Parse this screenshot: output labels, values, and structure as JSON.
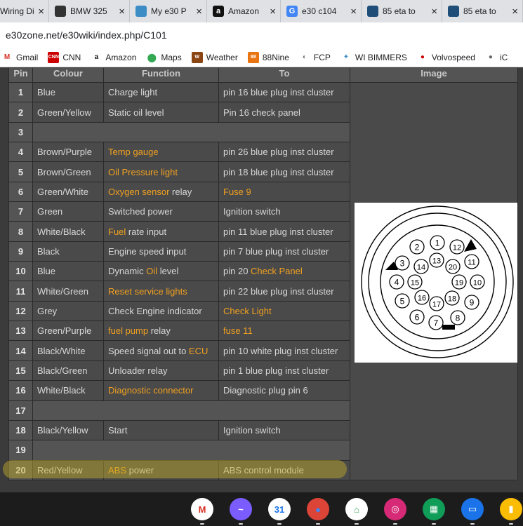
{
  "tabs": [
    {
      "title": "Wiring Di",
      "icon": "wiring-icon",
      "color": "#555555",
      "width": 70
    },
    {
      "title": "BMW 325",
      "icon": "bmw-icon",
      "color": "#333333",
      "width": 115
    },
    {
      "title": "My e30 P",
      "icon": "wi-bimmers-icon",
      "color": "#3c8dc5",
      "width": 110
    },
    {
      "title": "Amazon",
      "icon": "amazon-icon",
      "color": "#111111",
      "width": 105
    },
    {
      "title": "e30 c104",
      "icon": "google-icon",
      "color": "#4285f4",
      "width": 115
    },
    {
      "title": "85 eta to",
      "icon": "wiki-icon",
      "color": "#1f4e79",
      "width": 115
    },
    {
      "title": "85 eta to",
      "icon": "wiki-icon",
      "color": "#1f4e79",
      "width": 115
    }
  ],
  "address": {
    "url": "e30zone.net/e30wiki/index.php/C101"
  },
  "bookmarks": [
    {
      "label": "Gmail",
      "icon": "gmail-icon",
      "color": "#d93025"
    },
    {
      "label": "CNN",
      "icon": "cnn-icon",
      "color": "#cc0000"
    },
    {
      "label": "Amazon",
      "icon": "amazon-icon",
      "color": "#111111"
    },
    {
      "label": "Maps",
      "icon": "maps-icon",
      "color": "#34a853"
    },
    {
      "label": "Weather",
      "icon": "weather-icon",
      "color": "#8b4513"
    },
    {
      "label": "88Nine",
      "icon": "88nine-icon",
      "color": "#e87511"
    },
    {
      "label": "FCP",
      "icon": "fcp-icon",
      "color": "#777777"
    },
    {
      "label": "WI BIMMERS",
      "icon": "wi-bimmers-icon",
      "color": "#3c8dc5"
    },
    {
      "label": "Volvospeed",
      "icon": "volvospeed-icon",
      "color": "#cc0000"
    },
    {
      "label": "iC",
      "icon": "apple-icon",
      "color": "#666666"
    }
  ],
  "table": {
    "headers": [
      "Pin",
      "Colour",
      "Function",
      "To",
      "Image"
    ],
    "rows": [
      {
        "pin": "1",
        "colour": "Blue",
        "function": [
          {
            "t": "Charge light"
          }
        ],
        "to": [
          {
            "t": "pin 16 blue plug inst cluster"
          }
        ]
      },
      {
        "pin": "2",
        "colour": "Green/Yellow",
        "function": [
          {
            "t": "Static oil level"
          }
        ],
        "to": [
          {
            "t": "Pin 16 check panel"
          }
        ]
      },
      {
        "pin": "3",
        "empty": true
      },
      {
        "pin": "4",
        "colour": "Brown/Purple",
        "function": [
          {
            "t": "Temp gauge",
            "link": true
          }
        ],
        "to": [
          {
            "t": "pin 26 blue plug inst cluster"
          }
        ]
      },
      {
        "pin": "5",
        "colour": "Brown/Green",
        "function": [
          {
            "t": "Oil Pressure light",
            "link": true
          }
        ],
        "to": [
          {
            "t": "pin 18 blue plug inst cluster"
          }
        ]
      },
      {
        "pin": "6",
        "colour": "Green/White",
        "function": [
          {
            "t": "Oxygen sensor",
            "link": true
          },
          {
            "t": " relay"
          }
        ],
        "to": [
          {
            "t": "Fuse 9",
            "link": true
          }
        ]
      },
      {
        "pin": "7",
        "colour": "Green",
        "function": [
          {
            "t": "Switched power"
          }
        ],
        "to": [
          {
            "t": "Ignition switch"
          }
        ]
      },
      {
        "pin": "8",
        "colour": "White/Black",
        "function": [
          {
            "t": "Fuel",
            "link": true
          },
          {
            "t": " rate input"
          }
        ],
        "to": [
          {
            "t": "pin 11 blue plug inst cluster"
          }
        ]
      },
      {
        "pin": "9",
        "colour": "Black",
        "function": [
          {
            "t": "Engine speed input"
          }
        ],
        "to": [
          {
            "t": "pin 7 blue plug inst cluster"
          }
        ]
      },
      {
        "pin": "10",
        "colour": "Blue",
        "function": [
          {
            "t": "Dynamic "
          },
          {
            "t": "Oil",
            "link": true
          },
          {
            "t": " level"
          }
        ],
        "to": [
          {
            "t": "pin 20 "
          },
          {
            "t": "Check Panel",
            "link": true
          }
        ]
      },
      {
        "pin": "11",
        "colour": "White/Green",
        "function": [
          {
            "t": "Reset service lights",
            "link": true
          }
        ],
        "to": [
          {
            "t": "pin 22 blue plug inst cluster"
          }
        ]
      },
      {
        "pin": "12",
        "colour": "Grey",
        "function": [
          {
            "t": "Check Engine indicator"
          }
        ],
        "to": [
          {
            "t": "Check Light",
            "link": true
          }
        ]
      },
      {
        "pin": "13",
        "colour": "Green/Purple",
        "function": [
          {
            "t": "fuel pump",
            "link": true
          },
          {
            "t": " relay"
          }
        ],
        "to": [
          {
            "t": "fuse 11",
            "link": true
          }
        ]
      },
      {
        "pin": "14",
        "colour": "Black/White",
        "function": [
          {
            "t": "Speed signal out to "
          },
          {
            "t": "ECU",
            "link": true
          }
        ],
        "to": [
          {
            "t": "pin 10 white plug inst cluster"
          }
        ]
      },
      {
        "pin": "15",
        "colour": "Black/Green",
        "function": [
          {
            "t": "Unloader relay"
          }
        ],
        "to": [
          {
            "t": "pin 1 blue plug inst cluster"
          }
        ]
      },
      {
        "pin": "16",
        "colour": "White/Black",
        "function": [
          {
            "t": "Diagnostic connector",
            "link": true
          }
        ],
        "to": [
          {
            "t": "Diagnostic plug pin 6"
          }
        ]
      },
      {
        "pin": "17",
        "empty": true
      },
      {
        "pin": "18",
        "colour": "Black/Yellow",
        "function": [
          {
            "t": "Start"
          }
        ],
        "to": [
          {
            "t": "Ignition switch"
          }
        ]
      },
      {
        "pin": "19",
        "empty": true
      },
      {
        "pin": "20",
        "colour": "Red/Yellow",
        "function": [
          {
            "t": "ABS",
            "link": true
          },
          {
            "t": " power"
          }
        ],
        "to": [
          {
            "t": "ABS control module"
          }
        ]
      }
    ]
  },
  "connector_diagram": {
    "pins": [
      "1",
      "2",
      "3",
      "4",
      "5",
      "6",
      "7",
      "8",
      "9",
      "10",
      "11",
      "12",
      "13",
      "14",
      "15",
      "16",
      "17",
      "18",
      "19",
      "20"
    ]
  },
  "shelf": {
    "apps": [
      {
        "icon": "gmail-icon",
        "color": "#ffffff",
        "glyph": "M",
        "glyph_color": "#d93025"
      },
      {
        "icon": "messenger-icon",
        "color": "#7b5cff",
        "glyph": "~",
        "glyph_color": "#ffffff"
      },
      {
        "icon": "calendar-icon",
        "color": "#ffffff",
        "glyph": "31",
        "glyph_color": "#1a73e8"
      },
      {
        "icon": "chrome-icon",
        "color": "#db4437",
        "glyph": "●",
        "glyph_color": "#4285f4"
      },
      {
        "icon": "google-home-icon",
        "color": "#ffffff",
        "glyph": "⌂",
        "glyph_color": "#34a853"
      },
      {
        "icon": "instagram-icon",
        "color": "#d62976",
        "glyph": "◎",
        "glyph_color": "#ffffff"
      },
      {
        "icon": "sheets-icon",
        "color": "#0f9d58",
        "glyph": "▦",
        "glyph_color": "#ffffff"
      },
      {
        "icon": "files-icon",
        "color": "#1a73e8",
        "glyph": "▭",
        "glyph_color": "#ffffff"
      },
      {
        "icon": "keep-icon",
        "color": "#fbbc04",
        "glyph": "▮",
        "glyph_color": "#ffffff"
      }
    ]
  }
}
